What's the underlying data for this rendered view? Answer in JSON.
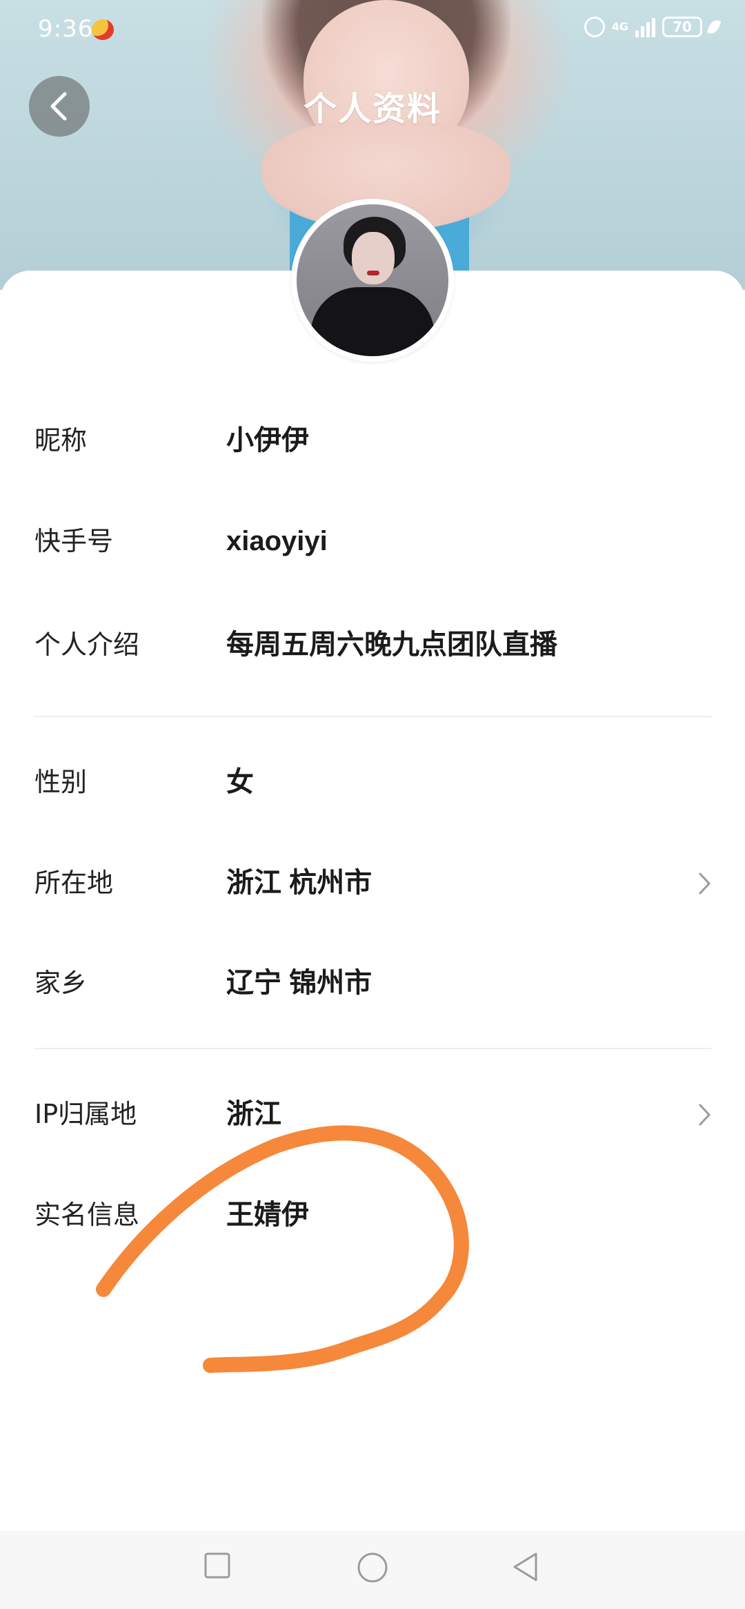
{
  "status_bar": {
    "time": "9:36",
    "network": "4G",
    "battery": "70",
    "icons": [
      "weibo-icon",
      "alarm-icon",
      "signal-icon",
      "battery-icon",
      "leaf-icon"
    ]
  },
  "header": {
    "title": "个人资料"
  },
  "profile": {
    "fields": [
      {
        "label": "昵称",
        "value": "小伊伊"
      },
      {
        "label": "快手号",
        "value": "xiaoyiyi"
      },
      {
        "label": "个人介绍",
        "value": "每周五周六晚九点团队直播"
      },
      {
        "label": "性别",
        "value": "女"
      },
      {
        "label": "所在地",
        "value": "浙江 杭州市"
      },
      {
        "label": "家乡",
        "value": "辽宁 锦州市"
      },
      {
        "label": "IP归属地",
        "value": "浙江"
      },
      {
        "label": "实名信息",
        "value": "王婧伊"
      }
    ]
  },
  "colors": {
    "annotation": "#F5883A",
    "card_bg": "#FFFFFF",
    "divider": "#EEEEEE"
  },
  "navbar": {
    "icons": [
      "recents-square-icon",
      "home-circle-icon",
      "back-triangle-icon"
    ]
  }
}
